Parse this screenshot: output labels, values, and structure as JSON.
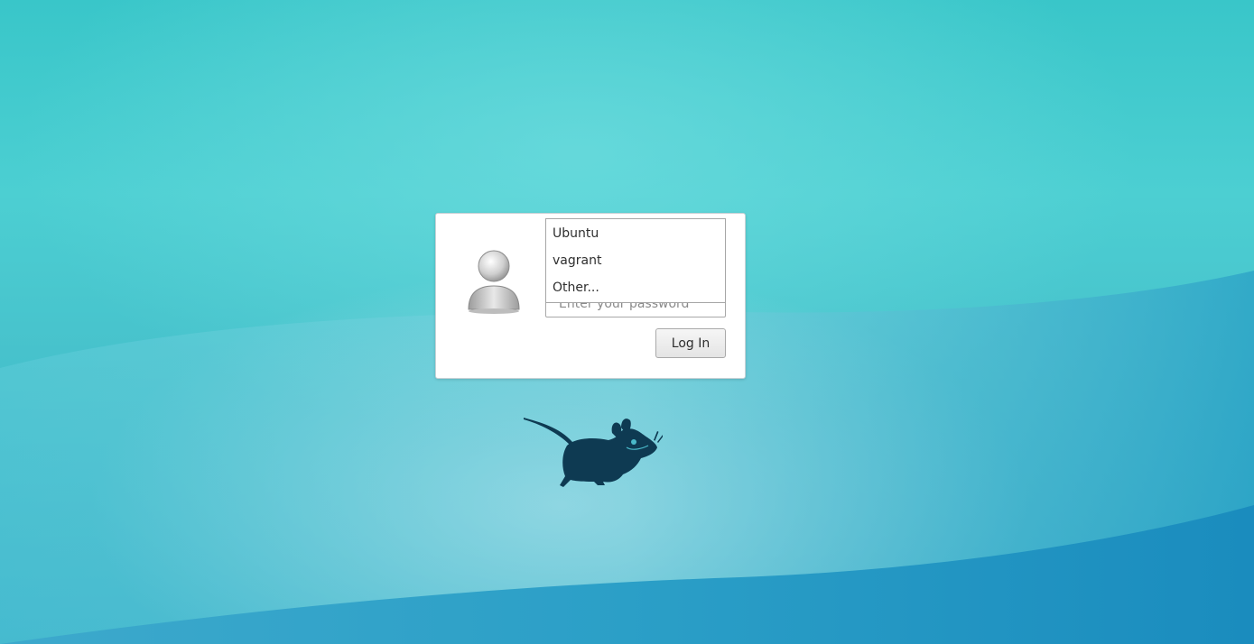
{
  "login": {
    "password_placeholder": "Enter your password",
    "login_button_label": "Log In"
  },
  "user_menu": {
    "options": [
      {
        "label": "Ubuntu"
      },
      {
        "label": "vagrant"
      },
      {
        "label": "Other..."
      }
    ]
  },
  "icons": {
    "avatar": "default-user-avatar-icon",
    "logo": "xfce-mouse-logo-icon"
  },
  "colors": {
    "background_top": "#39c6c9",
    "background_bottom": "#2aa6c4",
    "wave_dark": "#1f8fbf",
    "logo": "#0e3a52",
    "panel": "#ffffff"
  }
}
